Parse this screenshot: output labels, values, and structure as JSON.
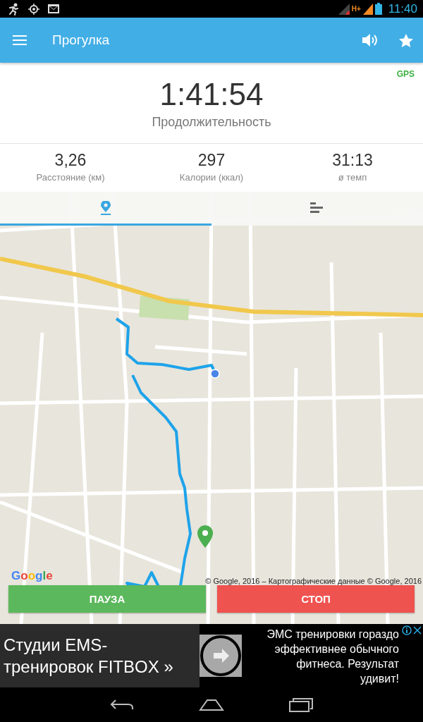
{
  "status_bar": {
    "network": "H+",
    "time": "11:40"
  },
  "app_bar": {
    "title": "Прогулка"
  },
  "workout": {
    "gps_label": "GPS",
    "duration": "1:41:54",
    "duration_label": "Продолжительность"
  },
  "stats": [
    {
      "value": "3,26",
      "label": "Расстояние (км)"
    },
    {
      "value": "297",
      "label": "Калории (ккал)"
    },
    {
      "value": "31:13",
      "label": "ø темп"
    }
  ],
  "view_tabs": [
    {
      "kind": "map",
      "selected": true
    },
    {
      "kind": "list",
      "selected": false
    }
  ],
  "map": {
    "logo": "Google",
    "attribution": "© Google, 2016 – Картографические данные © Google, 2016"
  },
  "controls": [
    {
      "kind": "pause",
      "label": "ПАУЗА"
    },
    {
      "kind": "stop",
      "label": "СТОП"
    }
  ],
  "ad": {
    "headline": "Студии EMS-тренировок FITBOX »",
    "body": "ЭМС тренировки гораздо эффективнее обычного фитнеса. Результат удивит!"
  }
}
